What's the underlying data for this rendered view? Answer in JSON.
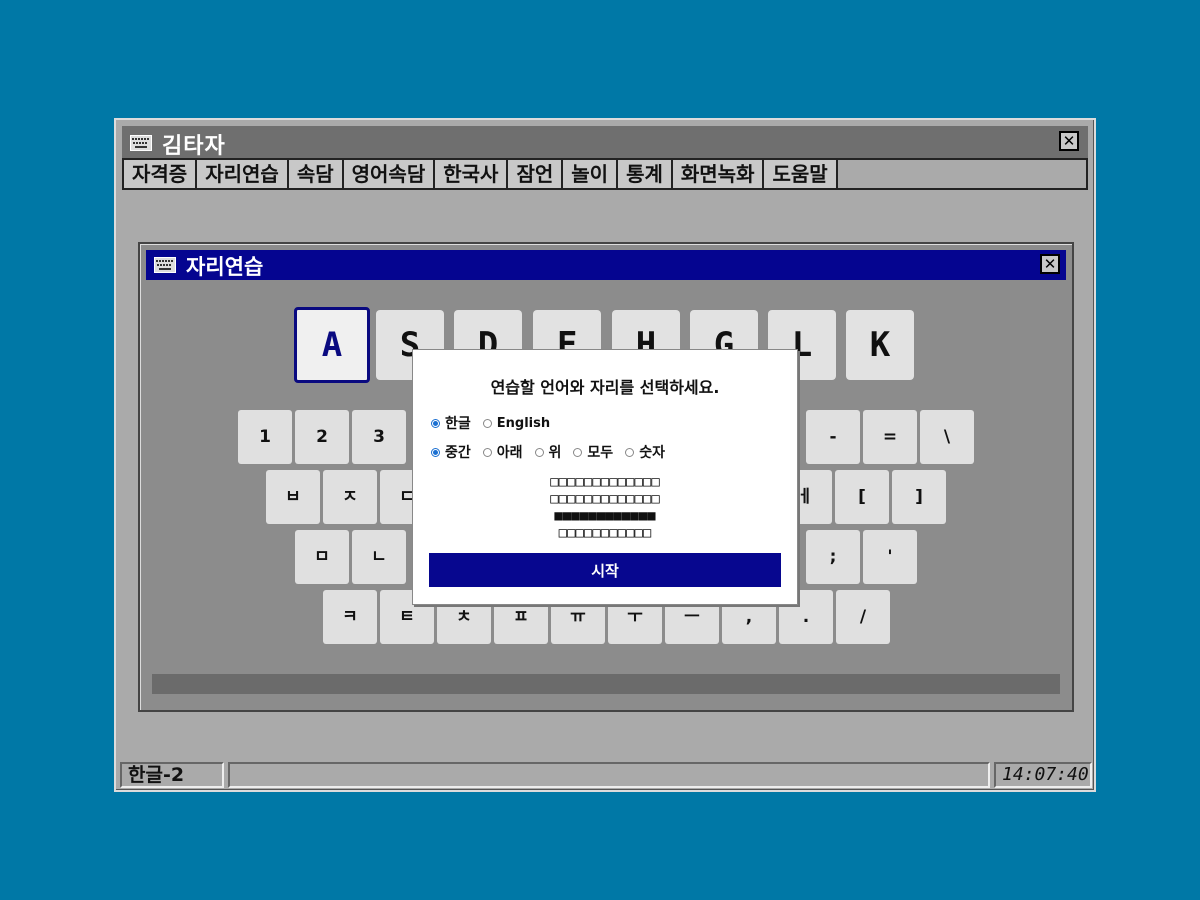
{
  "window": {
    "title": "김타자",
    "icon": "keyboard-icon",
    "close_label": "✕"
  },
  "menu": [
    "자격증",
    "자리연습",
    "속담",
    "영어속담",
    "한국사",
    "잠언",
    "놀이",
    "통계",
    "화면녹화",
    "도움말"
  ],
  "practice_window": {
    "title": "자리연습",
    "icon": "keyboard-icon",
    "close_label": "✕"
  },
  "target_keys": [
    "A",
    "S",
    "D",
    "F",
    "H",
    "G",
    "L",
    "K"
  ],
  "keyboard": {
    "row1_left": [
      "1",
      "2",
      "3"
    ],
    "row1_right": [
      "-",
      "=",
      "\\"
    ],
    "row2_left": [
      "ㅂ",
      "ㅈ",
      "ㄷ"
    ],
    "row2_right": [
      "ㅔ",
      "[",
      "]"
    ],
    "row3_left": [
      "ㅁ",
      "ㄴ"
    ],
    "row3_right": [
      ";",
      "'"
    ],
    "row4": [
      "ㅋ",
      "ㅌ",
      "ㅊ",
      "ㅍ",
      "ㅠ",
      "ㅜ",
      "ㅡ",
      ",",
      ".",
      "/"
    ]
  },
  "dialog": {
    "prompt": "연습할 언어와 자리를 선택하세요.",
    "language_options": [
      {
        "label": "한글",
        "checked": true
      },
      {
        "label": "English",
        "checked": false
      }
    ],
    "row_options": [
      {
        "label": "중간",
        "checked": true
      },
      {
        "label": "아래",
        "checked": false
      },
      {
        "label": "위",
        "checked": false
      },
      {
        "label": "모두",
        "checked": false
      },
      {
        "label": "숫자",
        "checked": false
      }
    ],
    "pattern": [
      "□□□□□□□□□□□□□",
      "□□□□□□□□□□□□□",
      "■■■■■■■■■■■■",
      "□□□□□□□□□□□"
    ],
    "start_label": "시작"
  },
  "statusbar": {
    "mode": "한글-2",
    "clock": "14:07:40"
  },
  "colors": {
    "desktop": "#0078a6",
    "accent": "#07078f",
    "radio": "#1a6fd1"
  }
}
